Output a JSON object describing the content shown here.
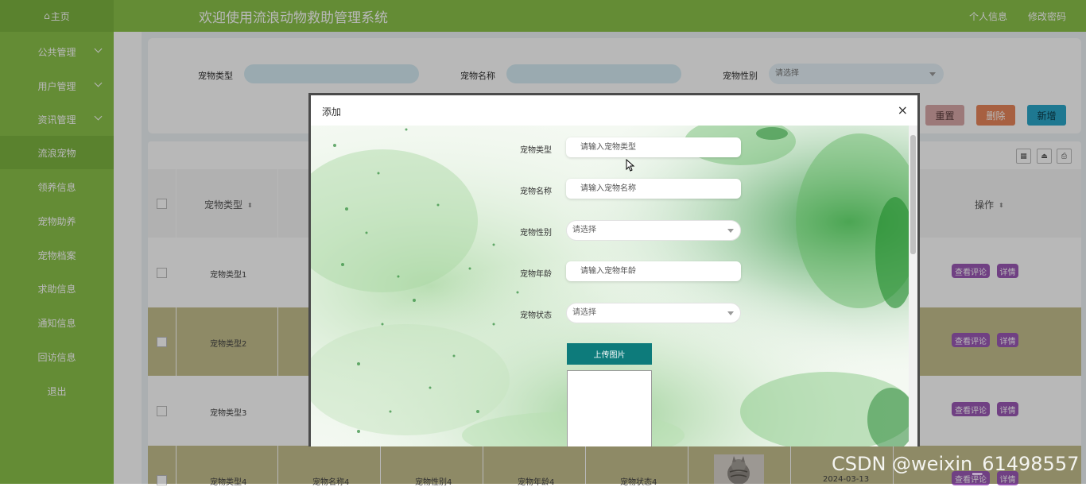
{
  "header": {
    "home_label": "主页",
    "home_icon": "home-icon",
    "system_title": "欢迎使用流浪动物救助管理系统",
    "profile_link": "个人信息",
    "password_link": "修改密码"
  },
  "sidebar": {
    "items": [
      {
        "label": "公共管理",
        "expandable": true
      },
      {
        "label": "用户管理",
        "expandable": true
      },
      {
        "label": "资讯管理",
        "expandable": true
      },
      {
        "label": "流浪宠物",
        "active": true
      },
      {
        "label": "领养信息"
      },
      {
        "label": "宠物助养"
      },
      {
        "label": "宠物档案"
      },
      {
        "label": "求助信息"
      },
      {
        "label": "通知信息"
      },
      {
        "label": "回访信息"
      },
      {
        "label": "退出"
      }
    ]
  },
  "search": {
    "type_label": "宠物类型",
    "name_label": "宠物名称",
    "gender_label": "宠物性别",
    "gender_select": "请选择",
    "reset_button": "重置",
    "delete_button": "删除",
    "add_button": "新增"
  },
  "table": {
    "header_type": "宠物类型",
    "header_actions": "操作",
    "rows": [
      {
        "type": "宠物类型1"
      },
      {
        "type": "宠物类型2"
      },
      {
        "type": "宠物类型3"
      },
      {
        "type": "宠物类型4",
        "name": "宠物名称4",
        "gender": "宠物性别4",
        "age": "宠物年龄4",
        "status": "宠物状态4",
        "date": "2024-03-13"
      }
    ],
    "comment_button": "查看评论",
    "detail_button": "详情"
  },
  "colors": {
    "sidebar": "#8bc34a",
    "sidebar_active": "#7db540",
    "reset": "#d9a8a8",
    "delete": "#e8865a",
    "add": "#2aa7c9",
    "row_highlight": "#c5c08e",
    "action_pill": "#9b59b6",
    "upload": "#0d7b7b"
  },
  "modal": {
    "title": "添加",
    "close": "×",
    "fields": {
      "type_label": "宠物类型",
      "type_placeholder": "请输入宠物类型",
      "name_label": "宠物名称",
      "name_placeholder": "请输入宠物名称",
      "gender_label": "宠物性别",
      "gender_select": "请选择",
      "age_label": "宠物年龄",
      "age_placeholder": "请输入宠物年龄",
      "status_label": "宠物状态",
      "status_select": "请选择"
    },
    "upload_button": "上传图片"
  },
  "watermark": "CSDN @weixin_61498557"
}
